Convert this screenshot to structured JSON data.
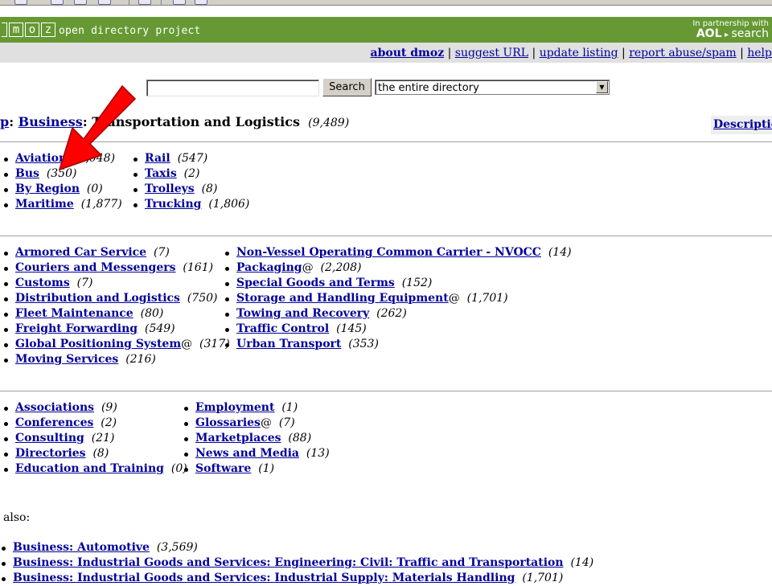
{
  "header": {
    "logo_letters": [
      "",
      "m",
      "o",
      "z"
    ],
    "tagline": "open directory project",
    "partner_text": "In partnership with",
    "partner_brand": "AOL",
    "partner_product": "search"
  },
  "top_links": {
    "about": "about dmoz",
    "suggest": "suggest URL",
    "update": "update listing",
    "report": "report abuse/spam",
    "help": "help",
    "separator": " | "
  },
  "search": {
    "button_label": "Search",
    "scope_selected": "the entire directory"
  },
  "breadcrumb": {
    "top": "p",
    "sep1": ": ",
    "business": "Business",
    "sep2": ": ",
    "current": "Transportation and Logistics",
    "count": "(9,489)"
  },
  "description_link": "Description",
  "section1": {
    "col1": [
      {
        "label": "Aviation",
        "count": "(2,048)"
      },
      {
        "label": "Bus",
        "count": "(350)"
      },
      {
        "label": "By Region",
        "count": "(0)"
      },
      {
        "label": "Maritime",
        "count": "(1,877)"
      }
    ],
    "col2": [
      {
        "label": "Rail",
        "count": "(547)"
      },
      {
        "label": "Taxis",
        "count": "(2)"
      },
      {
        "label": "Trolleys",
        "count": "(8)"
      },
      {
        "label": "Trucking",
        "count": "(1,806)"
      }
    ]
  },
  "section2": {
    "col1": [
      {
        "label": "Armored Car Service",
        "suffix": "",
        "count": "(7)"
      },
      {
        "label": "Couriers and Messengers",
        "suffix": "",
        "count": "(161)"
      },
      {
        "label": "Customs",
        "suffix": "",
        "count": "(7)"
      },
      {
        "label": "Distribution and Logistics",
        "suffix": "",
        "count": "(750)"
      },
      {
        "label": "Fleet Maintenance",
        "suffix": "",
        "count": "(80)"
      },
      {
        "label": "Freight Forwarding",
        "suffix": "",
        "count": "(549)"
      },
      {
        "label": "Global Positioning System",
        "suffix": "@",
        "count": "(317)"
      },
      {
        "label": "Moving Services",
        "suffix": "",
        "count": "(216)"
      }
    ],
    "col2": [
      {
        "label": "Non-Vessel Operating Common Carrier - NVOCC",
        "suffix": "",
        "count": "(14)"
      },
      {
        "label": "Packaging",
        "suffix": "@",
        "count": "(2,208)"
      },
      {
        "label": "Special Goods and Terms",
        "suffix": "",
        "count": "(152)"
      },
      {
        "label": "Storage and Handling Equipment",
        "suffix": "@",
        "count": "(1,701)"
      },
      {
        "label": "Towing and Recovery",
        "suffix": "",
        "count": "(262)"
      },
      {
        "label": "Traffic Control",
        "suffix": "",
        "count": "(145)"
      },
      {
        "label": "Urban Transport",
        "suffix": "",
        "count": "(353)"
      }
    ]
  },
  "section3": {
    "col1": [
      {
        "label": "Associations",
        "suffix": "",
        "count": "(9)"
      },
      {
        "label": "Conferences",
        "suffix": "",
        "count": "(2)"
      },
      {
        "label": "Consulting",
        "suffix": "",
        "count": "(21)"
      },
      {
        "label": "Directories",
        "suffix": "",
        "count": "(8)"
      },
      {
        "label": "Education and Training",
        "suffix": "",
        "count": "(0)"
      }
    ],
    "col2": [
      {
        "label": "Employment",
        "suffix": "",
        "count": "(1)"
      },
      {
        "label": "Glossaries",
        "suffix": "@",
        "count": "(7)"
      },
      {
        "label": "Marketplaces",
        "suffix": "",
        "count": "(88)"
      },
      {
        "label": "News and Media",
        "suffix": "",
        "count": "(13)"
      },
      {
        "label": "Software",
        "suffix": "",
        "count": "(1)"
      }
    ]
  },
  "see_also": {
    "label": "also:",
    "items": [
      {
        "label": "Business: Automotive",
        "count": "(3,569)"
      },
      {
        "label": "Business: Industrial Goods and Services: Engineering: Civil: Traffic and Transportation",
        "count": "(14)"
      },
      {
        "label": "Business: Industrial Goods and Services: Industrial Supply: Materials Handling",
        "count": "(1,701)"
      }
    ]
  },
  "colors": {
    "header_green": "#669933",
    "link_blue": "#000099",
    "annotation_red": "#ff0000",
    "subbar_gray": "#e0e0e0"
  }
}
